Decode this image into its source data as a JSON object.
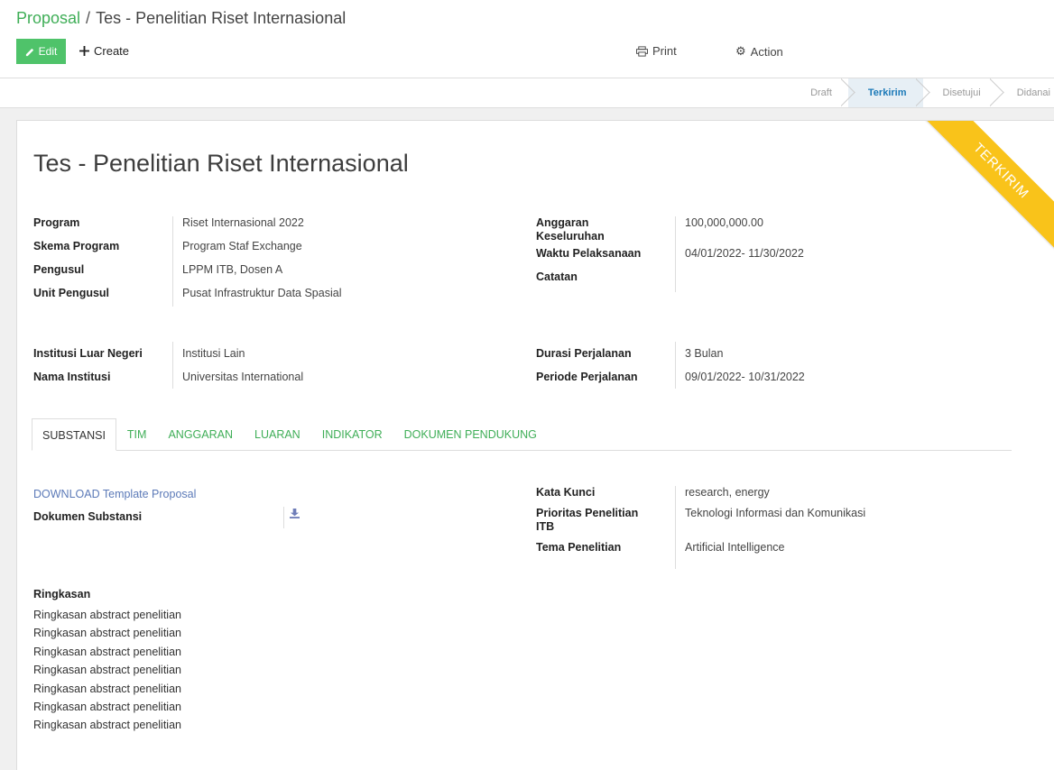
{
  "breadcrumb": {
    "parent": "Proposal",
    "separator": "/",
    "current": "Tes - Penelitian Riset Internasional"
  },
  "toolbar": {
    "edit_label": "Edit",
    "create_label": "Create",
    "print_label": "Print",
    "action_label": "Action"
  },
  "stages": [
    {
      "label": "Draft",
      "active": false
    },
    {
      "label": "Terkirim",
      "active": true
    },
    {
      "label": "Disetujui",
      "active": false
    },
    {
      "label": "Didanai",
      "active": false
    }
  ],
  "ribbon_label": "TERKIRIM",
  "record": {
    "title": "Tes - Penelitian Riset Internasional",
    "left_group": [
      {
        "label": "Program",
        "value": "Riset Internasional 2022"
      },
      {
        "label": "Skema Program",
        "value": "Program Staf Exchange"
      },
      {
        "label": "Pengusul",
        "value": "LPPM ITB, Dosen A"
      },
      {
        "label": "Unit Pengusul",
        "value": "Pusat Infrastruktur Data Spasial"
      }
    ],
    "right_group": [
      {
        "label": "Anggaran Keseluruhan",
        "value": "100,000,000.00"
      },
      {
        "label": "Waktu Pelaksanaan",
        "value": "04/01/2022- 11/30/2022"
      },
      {
        "label": "Catatan",
        "value": ""
      }
    ],
    "left_group2": [
      {
        "label": "Institusi Luar Negeri",
        "value": "Institusi Lain"
      },
      {
        "label": "Nama Institusi",
        "value": "Universitas International"
      }
    ],
    "right_group2": [
      {
        "label": "Durasi Perjalanan",
        "value": "3 Bulan"
      },
      {
        "label": "Periode Perjalanan",
        "value": "09/01/2022- 10/31/2022"
      }
    ]
  },
  "tabs": [
    "SUBSTANSI",
    "TIM",
    "ANGGARAN",
    "LUARAN",
    "INDIKATOR",
    "DOKUMEN PENDUKUNG"
  ],
  "substansi": {
    "download_link": "DOWNLOAD Template Proposal",
    "dokumen_label": "Dokumen Substansi",
    "right": [
      {
        "label": "Kata Kunci",
        "value": "research, energy"
      },
      {
        "label": "Prioritas Penelitian ITB",
        "value": "Teknologi Informasi dan Komunikasi"
      },
      {
        "label": "Tema Penelitian",
        "value": "Artificial Intelligence"
      }
    ],
    "ringkasan_label": "Ringkasan",
    "ringkasan_text": "Ringkasan abstract penelitian\nRingkasan abstract penelitian\nRingkasan abstract penelitian\nRingkasan abstract penelitian\nRingkasan abstract penelitian\nRingkasan abstract penelitian\nRingkasan abstract penelitian"
  },
  "colors": {
    "accent_green": "#4fc36a",
    "link_green": "#3fae57",
    "ribbon": "#f9c31a",
    "active_stage": "#1b79b8"
  }
}
